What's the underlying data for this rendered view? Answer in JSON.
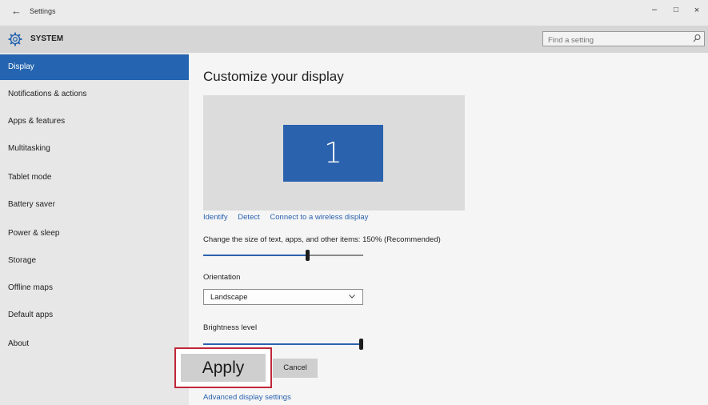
{
  "window": {
    "back_glyph": "←",
    "title": "Settings",
    "minimize_glyph": "–",
    "maximize_glyph": "□",
    "close_glyph": "×"
  },
  "header": {
    "icon": "gear-icon",
    "section_title": "SYSTEM",
    "search_placeholder": "Find a setting",
    "search_icon": "search-icon"
  },
  "sidebar": {
    "items": [
      {
        "label": "Display",
        "active": true
      },
      {
        "label": "Notifications & actions"
      },
      {
        "label": "Apps & features"
      },
      {
        "label": "Multitasking"
      },
      {
        "label": "Tablet mode"
      },
      {
        "label": "Battery saver"
      },
      {
        "label": "Power & sleep"
      },
      {
        "label": "Storage"
      },
      {
        "label": "Offline maps"
      },
      {
        "label": "Default apps"
      },
      {
        "label": "About"
      }
    ]
  },
  "main": {
    "heading": "Customize your display",
    "monitor_number": "1",
    "links": {
      "identify": "Identify",
      "detect": "Detect",
      "wireless": "Connect to a wireless display"
    },
    "scale_label": "Change the size of text, apps, and other items: 150% (Recommended)",
    "scale_slider_fraction": 0.65,
    "orientation_label": "Orientation",
    "orientation_value": "Landscape",
    "brightness_label": "Brightness level",
    "brightness_slider_fraction": 1.0,
    "apply_label": "Apply",
    "cancel_label": "Cancel",
    "advanced_link": "Advanced display settings"
  },
  "colors": {
    "accent": "#2464b0",
    "highlight_border": "#c0283a"
  }
}
